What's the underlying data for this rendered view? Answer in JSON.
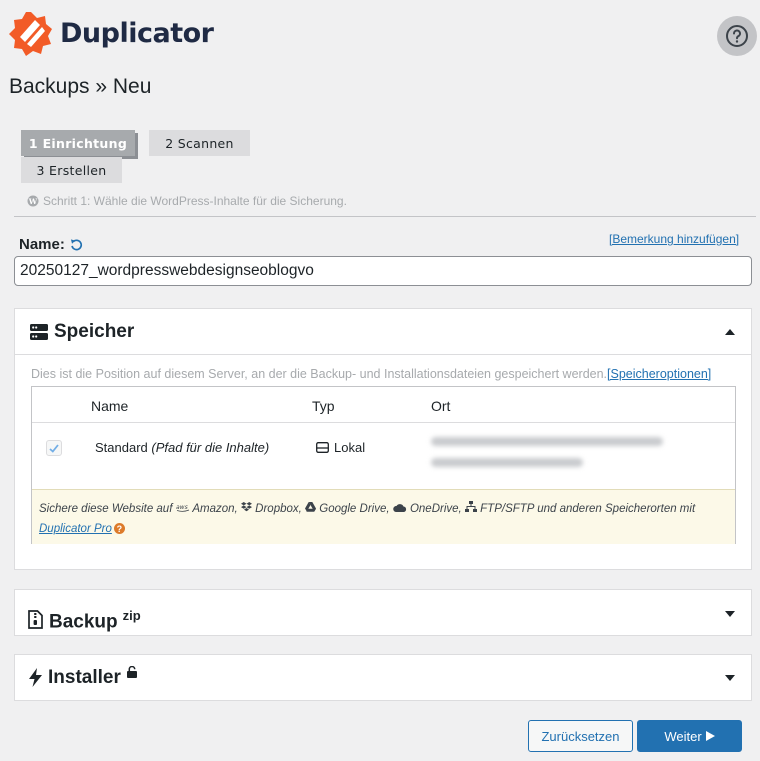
{
  "header": {
    "brand": "Duplicator",
    "page_title": "Backups » Neu",
    "help_icon": "question-circle-icon"
  },
  "steps": [
    {
      "label": "1 Einrichtung",
      "active": true
    },
    {
      "label": "2 Scannen",
      "active": false
    },
    {
      "label": "3 Erstellen",
      "active": false
    }
  ],
  "step_hint": "Schritt 1: Wähle die WordPress-Inhalte für die Sicherung.",
  "name_section": {
    "label": "Name:",
    "add_note_link": "[Bemerkung hinzufügen]",
    "value": "20250127_wordpresswebdesignseoblogvo"
  },
  "storage": {
    "title": "Speicher",
    "description": "Dies ist die Position auf diesem Server, an der die Backup- und Installationsdateien gespeichert werden.",
    "options_link": "[Speicheroptionen]",
    "columns": [
      "Name",
      "Typ",
      "Ort"
    ],
    "row": {
      "name": "Standard",
      "name_note": "(Pfad für die Inhalte)",
      "type": "Lokal",
      "checked": true
    },
    "promo": {
      "prefix": "Sichere diese Website auf",
      "amazon": "Amazon,",
      "dropbox": "Dropbox,",
      "gdrive": "Google Drive,",
      "onedrive": "OneDrive,",
      "ftp": "FTP/SFTP und anderen Speicherorten mit",
      "link": "Duplicator Pro"
    }
  },
  "backup": {
    "title": "Backup",
    "sup": "zip"
  },
  "installer": {
    "title": "Installer"
  },
  "buttons": {
    "reset": "Zurücksetzen",
    "next": "Weiter"
  },
  "colors": {
    "brand_orange": "#f25b27",
    "link_blue": "#2271b1",
    "promo_bg": "#fcf9e8"
  }
}
